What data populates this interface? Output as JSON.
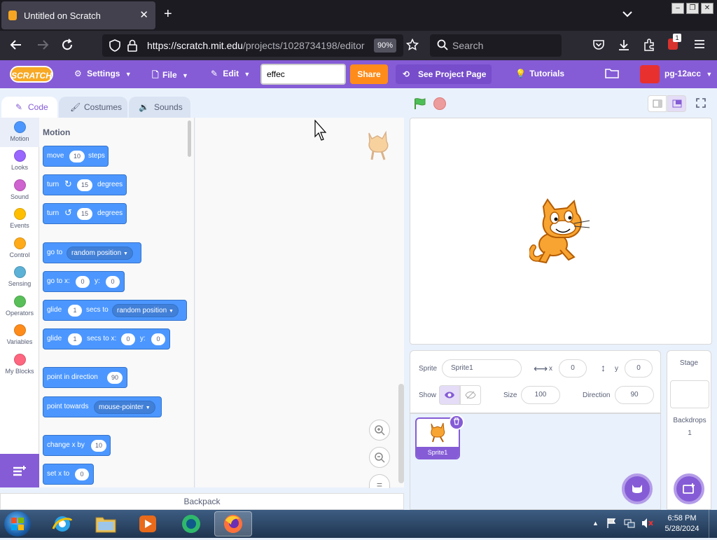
{
  "browser": {
    "tab_title": "Untitled on Scratch",
    "tab_close": "✕",
    "new_tab": "+",
    "list_tabs": "⌄",
    "url_host": "https://scratch.mit.edu",
    "url_path": "/projects/1028734198/editor",
    "zoom": "90%",
    "search_placeholder": "Search",
    "extensions_badge": "1"
  },
  "menubar": {
    "logo": "SCRATCH",
    "settings": "Settings",
    "file": "File",
    "edit": "Edit",
    "search_value": "effec",
    "share": "Share",
    "see_project": "See Project Page",
    "tutorials": "Tutorials",
    "username": "pg-12acc"
  },
  "editor_tabs": [
    "Code",
    "Costumes",
    "Sounds"
  ],
  "categories": [
    {
      "label": "Motion",
      "color": "#4c97ff"
    },
    {
      "label": "Looks",
      "color": "#9966ff"
    },
    {
      "label": "Sound",
      "color": "#cf63cf"
    },
    {
      "label": "Events",
      "color": "#ffbf00"
    },
    {
      "label": "Control",
      "color": "#ffab19"
    },
    {
      "label": "Sensing",
      "color": "#5cb1d6"
    },
    {
      "label": "Operators",
      "color": "#59c059"
    },
    {
      "label": "Variables",
      "color": "#ff8c1a"
    },
    {
      "label": "My Blocks",
      "color": "#ff6680"
    }
  ],
  "palette": {
    "section_title": "Motion",
    "blocks": {
      "move": {
        "pre": "move",
        "value": "10",
        "post": "steps"
      },
      "turn_right": {
        "pre": "turn",
        "value": "15",
        "post": "degrees"
      },
      "turn_left": {
        "pre": "turn",
        "value": "15",
        "post": "degrees"
      },
      "goto": {
        "pre": "go to",
        "menu": "random position"
      },
      "goto_xy": {
        "pre": "go to x:",
        "x": "0",
        "ylabel": "y:",
        "y": "0"
      },
      "glide_to": {
        "pre": "glide",
        "secs": "1",
        "mid": "secs to",
        "menu": "random position"
      },
      "glide_xy": {
        "pre": "glide",
        "secs": "1",
        "mid": "secs to x:",
        "x": "0",
        "ylabel": "y:",
        "y": "0"
      },
      "point_dir": {
        "pre": "point in direction",
        "value": "90"
      },
      "point_towards": {
        "pre": "point towards",
        "menu": "mouse-pointer"
      },
      "change_x": {
        "pre": "change x by",
        "value": "10"
      },
      "set_x": {
        "pre": "set x to",
        "value": "0"
      }
    }
  },
  "zoom_controls": {
    "zoom_in": "+",
    "zoom_out": "−",
    "reset": "="
  },
  "backpack": "Backpack",
  "sprite_info": {
    "sprite_label": "Sprite",
    "sprite_name": "Sprite1",
    "x_label": "x",
    "x_value": "0",
    "y_label": "y",
    "y_value": "0",
    "show_label": "Show",
    "size_label": "Size",
    "size_value": "100",
    "direction_label": "Direction",
    "direction_value": "90"
  },
  "sprite_list": [
    {
      "name": "Sprite1"
    }
  ],
  "stage_panel": {
    "title": "Stage",
    "backdrops_label": "Backdrops",
    "backdrops_count": "1"
  },
  "taskbar": {
    "time": "6:58 PM",
    "date": "5/28/2024"
  }
}
